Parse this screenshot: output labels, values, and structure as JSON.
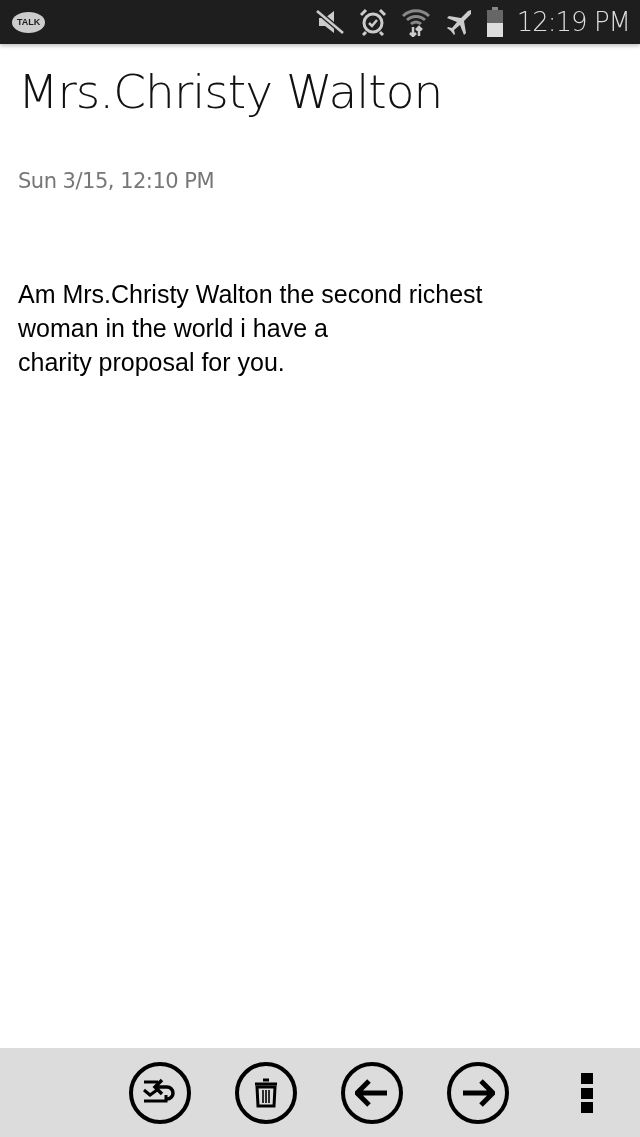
{
  "status_bar": {
    "app_badge": "TALK",
    "time": "12:19 PM"
  },
  "message": {
    "sender": "Mrs.Christy Walton",
    "date": "Sun 3/15, 12:10 PM",
    "body_lines": [
      "Am Mrs.Christy Walton the second richest",
      "woman in the world i have a",
      "charity proposal for you."
    ]
  },
  "toolbar": {
    "buttons": [
      {
        "kind": "reply"
      },
      {
        "kind": "delete"
      },
      {
        "kind": "previous"
      },
      {
        "kind": "next"
      },
      {
        "kind": "more"
      }
    ]
  }
}
